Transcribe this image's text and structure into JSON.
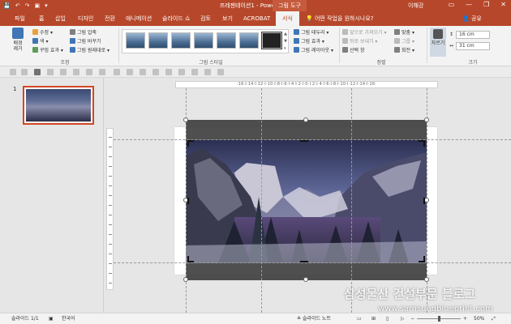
{
  "titlebar": {
    "title": "프레젠테이션1 - PowerPoint",
    "context_tab": "그림 도구",
    "user": "이해강",
    "qat": [
      "💾",
      "↶",
      "↷",
      "▣",
      "▾"
    ],
    "win_buttons": [
      "▭",
      "—",
      "❐",
      "✕"
    ]
  },
  "tabs": {
    "items": [
      "파일",
      "홈",
      "삽입",
      "디자인",
      "전환",
      "애니메이션",
      "슬라이드 쇼",
      "검토",
      "보기",
      "ACROBAT"
    ],
    "active": "서식",
    "tell_me": "어떤 작업을 원하시나요?",
    "share": "공유"
  },
  "ribbon": {
    "remove_bg": "배경\n제거",
    "corrections": "수정",
    "color": "색",
    "artistic": "꾸밈 효과",
    "compress": "그림 압축",
    "change": "그림 바꾸기",
    "reset": "그림 원래대로",
    "group_adjust": "조정",
    "group_styles": "그림 스타일",
    "border": "그림 테두리",
    "effects": "그림 효과",
    "layout": "그림 레이아웃",
    "bring_forward": "앞으로 가져오기",
    "send_backward": "뒤로 보내기",
    "selection_pane": "선택 창",
    "align": "맞춤",
    "group": "그룹",
    "rotate": "회전",
    "group_arrange": "정렬",
    "crop": "자르기",
    "height": "16 cm",
    "width": "31 cm",
    "group_size": "크기"
  },
  "pane": {
    "slide_number": "1"
  },
  "ruler": {
    "h_labels": "·16·I·14·I·12·I·10·I·8·I·6·I·4·I·2·I·0·I·2·I·4·I·6·I·8·I·10·I·12·I·14·I·16·"
  },
  "watermark": {
    "line1": "삼성물산 건설부문 블로그",
    "line2": "www.samsungblueprint.com"
  },
  "status": {
    "slide_info": "슬라이드 1/1",
    "language": "한국어",
    "notes": "슬라이드 노트",
    "zoom": "50%"
  },
  "colors": {
    "accent": "#b7472a",
    "selection": "#d24726"
  }
}
